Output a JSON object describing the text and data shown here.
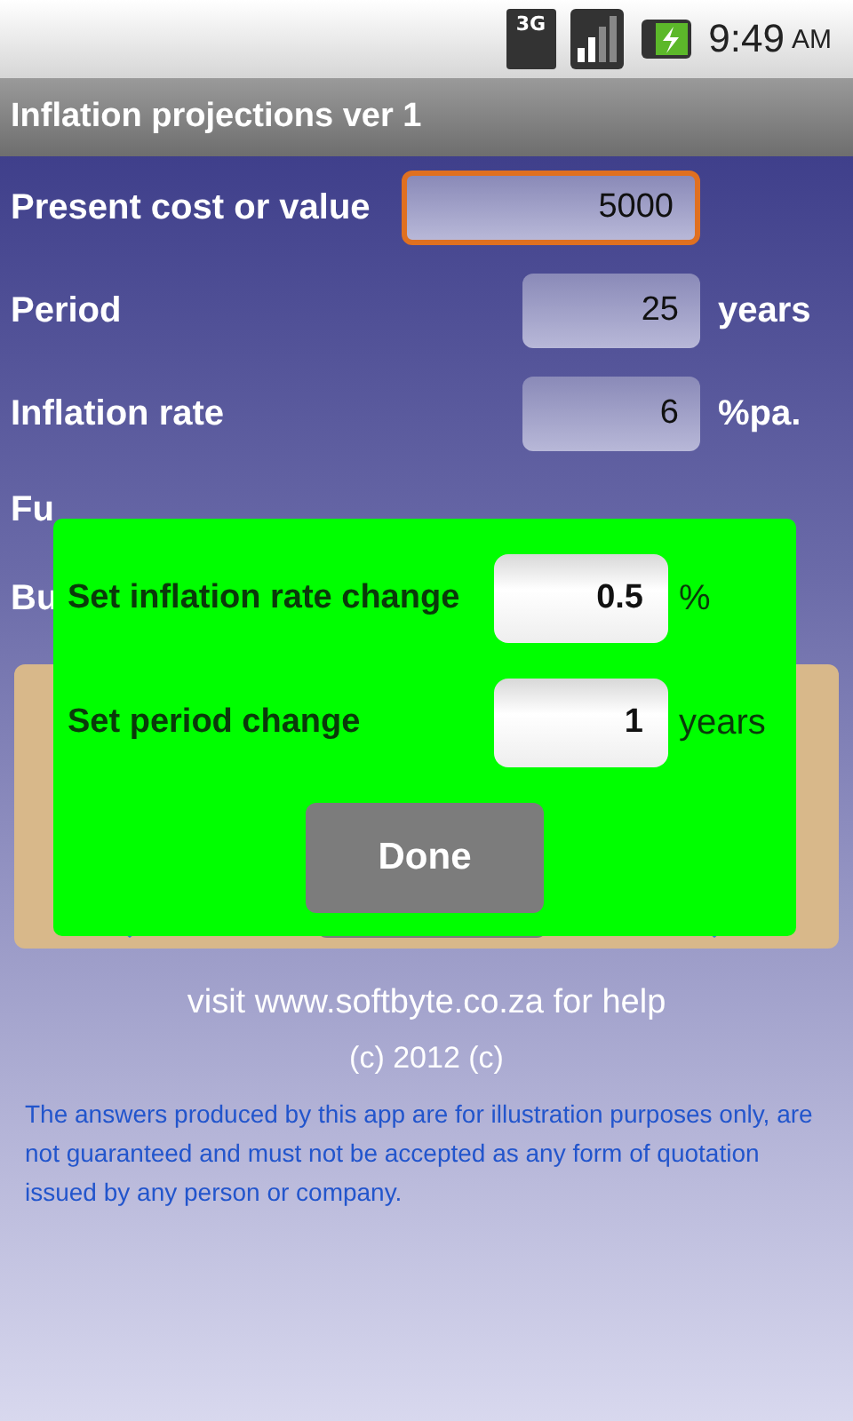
{
  "status_bar": {
    "network": "3G",
    "time": "9:49",
    "meridiem": "AM"
  },
  "title_bar": {
    "title": "Inflation projections ver 1"
  },
  "form": [
    {
      "label": "Present cost or value",
      "value": "5000",
      "focused": true
    },
    {
      "label": "Period",
      "value": "25",
      "unit": "years",
      "focused": false
    },
    {
      "label": "Inflation rate",
      "value": "6",
      "unit": "%pa.",
      "focused": false
    }
  ],
  "hidden_labels": [
    "Fu",
    "Bu"
  ],
  "dialog": {
    "fields": [
      {
        "label": "Set inflation rate change",
        "value": "0.5",
        "unit": "%"
      },
      {
        "label": "Set period change",
        "value": "1",
        "unit": "years"
      }
    ],
    "button": "Done"
  },
  "footer": {
    "help": "visit www.softbyte.co.za for help",
    "copyright": "(c) 2012 (c)",
    "disclaimer": "The answers produced by this app are for illustration purposes only, are not guaranteed and must not be accepted as any form of quotation issued by any person or company."
  }
}
